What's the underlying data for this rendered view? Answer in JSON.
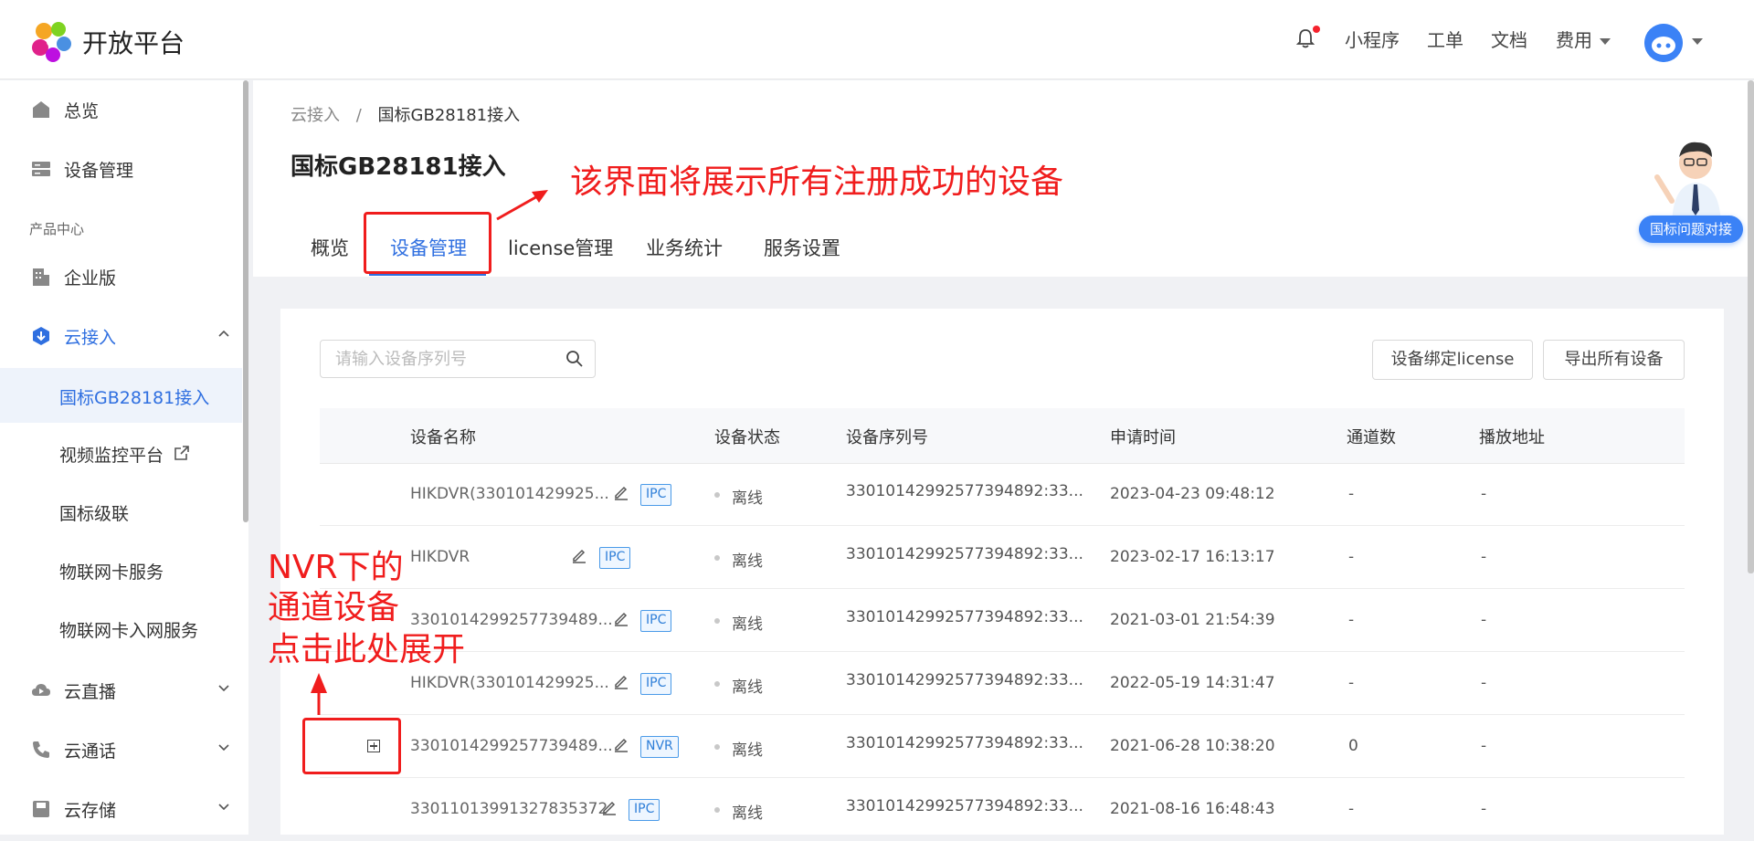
{
  "header": {
    "brand": "开放平台",
    "nav": [
      "小程序",
      "工单",
      "文档"
    ],
    "fee_label": "费用"
  },
  "sidebar": {
    "overview": "总览",
    "device_mgmt": "设备管理",
    "group_label": "产品中心",
    "enterprise": "企业版",
    "cloud_access": "云接入",
    "sub_items": [
      "国标GB28181接入",
      "视频监控平台",
      "国标级联",
      "物联网卡服务",
      "物联网卡入网服务"
    ],
    "cloud_live": "云直播",
    "cloud_call": "云通话",
    "cloud_storage": "云存储"
  },
  "breadcrumb": {
    "parent": "云接入",
    "sep": "/",
    "current": "国标GB28181接入"
  },
  "page_title": "国标GB28181接入",
  "tabs": [
    "概览",
    "设备管理",
    "license管理",
    "业务统计",
    "服务设置"
  ],
  "toolbar": {
    "search_placeholder": "请输入设备序列号",
    "bind_license": "设备绑定license",
    "export_all": "导出所有设备"
  },
  "table": {
    "columns": [
      "设备名称",
      "设备状态",
      "设备序列号",
      "申请时间",
      "通道数",
      "播放地址"
    ],
    "rows": [
      {
        "name": "HIKDVR(330101429925...",
        "tag": "IPC",
        "status": "离线",
        "serial": "33010142992577394892:33...",
        "time": "2023-04-23 09:48:12",
        "channels": "-",
        "play": "-"
      },
      {
        "name": "HIKDVR",
        "tag": "IPC",
        "status": "离线",
        "serial": "33010142992577394892:33...",
        "time": "2023-02-17 16:13:17",
        "channels": "-",
        "play": "-"
      },
      {
        "name": "330101429925773948​9...",
        "tag": "IPC",
        "status": "离线",
        "serial": "33010142992577394892:33...",
        "time": "2021-03-01 21:54:39",
        "channels": "-",
        "play": "-"
      },
      {
        "name": "HIKDVR(330101429925...",
        "tag": "IPC",
        "status": "离线",
        "serial": "33010142992577394892:33...",
        "time": "2022-05-19 14:31:47",
        "channels": "-",
        "play": "-"
      },
      {
        "name": "330101429925773948​9...",
        "tag": "NVR",
        "status": "离线",
        "serial": "33010142992577394892:33...",
        "time": "2021-06-28 10:38:20",
        "channels": "0",
        "play": "-"
      },
      {
        "name": "33011013991327835372",
        "tag": "IPC",
        "status": "离线",
        "serial": "33010142992577394892:33...",
        "time": "2021-08-16 16:48:43",
        "channels": "-",
        "play": "-"
      }
    ]
  },
  "annotations": {
    "top": "该界面将展示所有注册成功的设备",
    "left_line1": "NVR下的",
    "left_line2": "通道设备",
    "left_line3": "点击此处展开"
  },
  "helper_label": "国标问题对接",
  "colors": {
    "accent": "#2f6fe0",
    "annotation": "#f01d1d",
    "tag_border": "#4a9ae8"
  }
}
